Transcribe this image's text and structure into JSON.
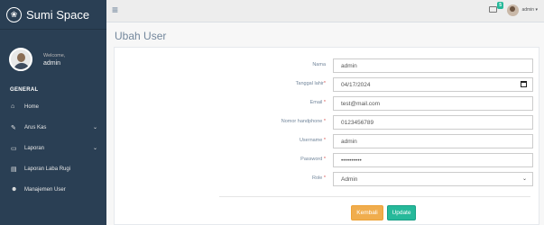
{
  "brand": {
    "title": "Sumi Space",
    "icon": "paw-icon"
  },
  "profile": {
    "welcome": "Welcome,",
    "name": "admin"
  },
  "sidebar": {
    "section": "GENERAL",
    "items": [
      {
        "label": "Home",
        "icon": "home-icon"
      },
      {
        "label": "Arus Kas",
        "icon": "edit-icon"
      },
      {
        "label": "Laporan",
        "icon": "desktop-icon"
      },
      {
        "label": "Laporan Laba Rugi",
        "icon": "table-icon"
      },
      {
        "label": "Manajemen User",
        "icon": "users-icon"
      }
    ]
  },
  "topbar": {
    "badge": "5",
    "user": "admin"
  },
  "page": {
    "title": "Ubah User"
  },
  "form": {
    "nama_label": "Nama",
    "nama_value": "admin",
    "tanggal_label": "Tanggal lahir",
    "tanggal_value": "04/17/2024",
    "email_label": "Email",
    "email_value": "test@mail.com",
    "phone_label": "Nomor handphone",
    "phone_value": "0123456789",
    "username_label": "Username",
    "username_value": "admin",
    "password_label": "Password",
    "password_value": "••••••••••",
    "role_label": "Role",
    "role_value": "Admin",
    "required_mark": "*"
  },
  "buttons": {
    "back": "Kembali",
    "update": "Update"
  },
  "colors": {
    "sidebar": "#2a3f54",
    "accent": "#26b99a",
    "warning": "#f0ad4e"
  }
}
